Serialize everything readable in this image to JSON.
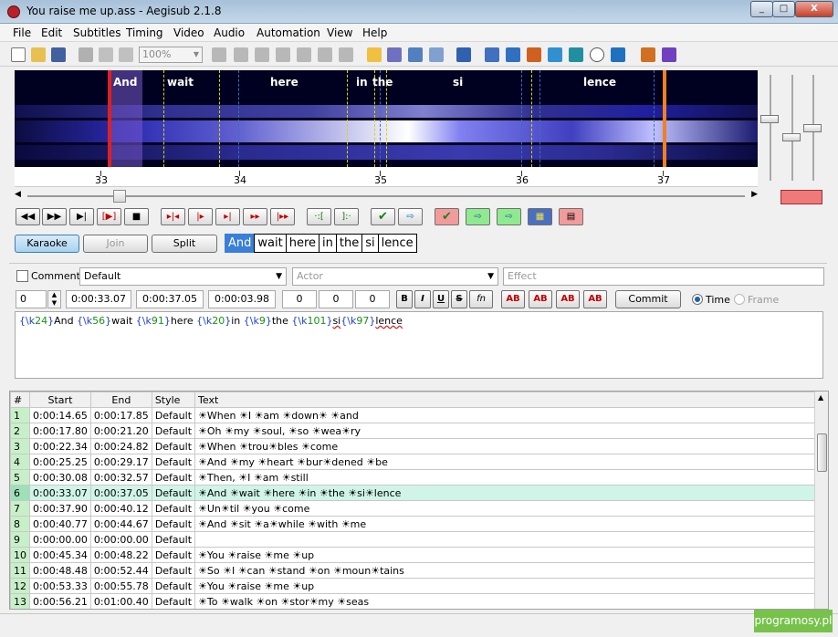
{
  "window": {
    "title": "You raise me up.ass - Aegisub 2.1.8",
    "minimize": "_",
    "maximize": "□",
    "close": "X"
  },
  "menu": [
    "File",
    "Edit",
    "Subtitles",
    "Timing",
    "Video",
    "Audio",
    "Automation",
    "View",
    "Help"
  ],
  "toolbar": {
    "zoom_value": "100%"
  },
  "audio": {
    "syllables": [
      {
        "text": "And",
        "time": 33.17
      },
      {
        "text": "wait",
        "time": 33.48
      },
      {
        "text": "here",
        "time": 34.22
      },
      {
        "text": "in",
        "time": 34.88
      },
      {
        "text": "the",
        "time": 35.0
      },
      {
        "text": "si",
        "time": 35.58
      },
      {
        "text": "lence",
        "time": 36.45
      }
    ],
    "ruler_labels": [
      "33",
      "34",
      "35",
      "36",
      "37"
    ],
    "scroll_position": 0.14
  },
  "karaoke": {
    "karaoke_label": "Karaoke",
    "join_label": "Join",
    "split_label": "Split",
    "syllables": [
      "And",
      "wait",
      "here",
      "in",
      "the",
      "si",
      "lence"
    ]
  },
  "edit": {
    "comment_label": "Comment",
    "style_value": "Default",
    "actor_placeholder": "Actor",
    "effect_placeholder": "Effect",
    "layer": "0",
    "start": "0:00:33.07",
    "end": "0:00:37.05",
    "duration": "0:00:03.98",
    "margin_l": "0",
    "margin_r": "0",
    "margin_v": "0",
    "bold": "B",
    "italic": "I",
    "underline": "U",
    "strike": "S",
    "font": "fn",
    "color_label": "AB",
    "commit_label": "Commit",
    "time_label": "Time",
    "frame_label": "Frame",
    "text_parts": [
      {
        "k": "24",
        "t": "And "
      },
      {
        "k": "56",
        "t": "wait "
      },
      {
        "k": "91",
        "t": "here "
      },
      {
        "k": "20",
        "t": "in "
      },
      {
        "k": "9",
        "t": "the "
      },
      {
        "k": "101",
        "t": "si"
      },
      {
        "k": "97",
        "t": "lence"
      }
    ]
  },
  "grid": {
    "columns": [
      "#",
      "Start",
      "End",
      "Style",
      "Text"
    ],
    "rows": [
      {
        "n": "1",
        "start": "0:00:14.65",
        "end": "0:00:17.85",
        "style": "Default",
        "text": "☀When ☀I ☀am ☀down☀ ☀and"
      },
      {
        "n": "2",
        "start": "0:00:17.80",
        "end": "0:00:21.20",
        "style": "Default",
        "text": "☀Oh ☀my ☀soul, ☀so ☀wea☀ry"
      },
      {
        "n": "3",
        "start": "0:00:22.34",
        "end": "0:00:24.82",
        "style": "Default",
        "text": "☀When ☀trou☀bles ☀come"
      },
      {
        "n": "4",
        "start": "0:00:25.25",
        "end": "0:00:29.17",
        "style": "Default",
        "text": "☀And ☀my ☀heart ☀bur☀dened ☀be"
      },
      {
        "n": "5",
        "start": "0:00:30.08",
        "end": "0:00:32.57",
        "style": "Default",
        "text": "☀Then, ☀I ☀am ☀still"
      },
      {
        "n": "6",
        "start": "0:00:33.07",
        "end": "0:00:37.05",
        "style": "Default",
        "text": "☀And ☀wait ☀here ☀in ☀the ☀si☀lence",
        "current": true
      },
      {
        "n": "7",
        "start": "0:00:37.90",
        "end": "0:00:40.12",
        "style": "Default",
        "text": "☀Un☀til ☀you ☀come"
      },
      {
        "n": "8",
        "start": "0:00:40.77",
        "end": "0:00:44.67",
        "style": "Default",
        "text": "☀And ☀sit ☀a☀while ☀with ☀me"
      },
      {
        "n": "9",
        "start": "0:00:00.00",
        "end": "0:00:00.00",
        "style": "Default",
        "text": ""
      },
      {
        "n": "10",
        "start": "0:00:45.34",
        "end": "0:00:48.22",
        "style": "Default",
        "text": "☀You ☀raise ☀me ☀up"
      },
      {
        "n": "11",
        "start": "0:00:48.48",
        "end": "0:00:52.44",
        "style": "Default",
        "text": "☀So ☀I ☀can ☀stand ☀on ☀moun☀tains"
      },
      {
        "n": "12",
        "start": "0:00:53.33",
        "end": "0:00:55.78",
        "style": "Default",
        "text": "☀You ☀raise ☀me ☀up"
      },
      {
        "n": "13",
        "start": "0:00:56.21",
        "end": "0:01:00.40",
        "style": "Default",
        "text": "☀To ☀walk ☀on ☀stor☀my ☀seas"
      }
    ]
  },
  "watermark": "programosy.pl"
}
